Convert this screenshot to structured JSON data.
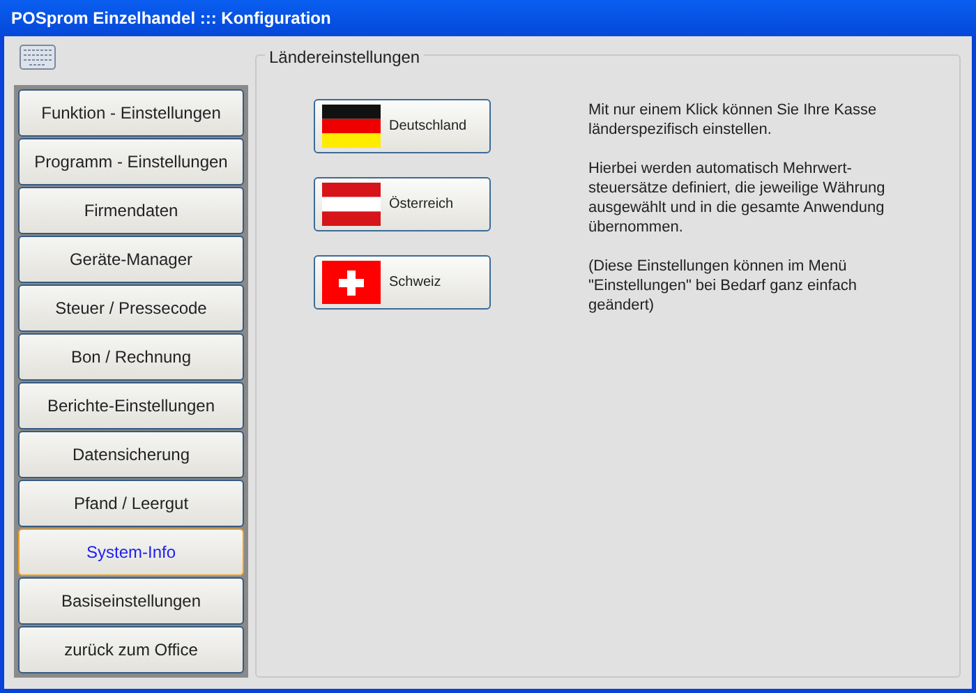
{
  "window": {
    "title": "POSprom Einzelhandel ::: Konfiguration"
  },
  "sidebar": {
    "items": [
      {
        "label": "Funktion - Einstellungen",
        "selected": false
      },
      {
        "label": "Programm - Einstellungen",
        "selected": false
      },
      {
        "label": "Firmendaten",
        "selected": false
      },
      {
        "label": "Geräte-Manager",
        "selected": false
      },
      {
        "label": "Steuer / Pressecode",
        "selected": false
      },
      {
        "label": "Bon / Rechnung",
        "selected": false
      },
      {
        "label": "Berichte-Einstellungen",
        "selected": false
      },
      {
        "label": "Datensicherung",
        "selected": false
      },
      {
        "label": "Pfand / Leergut",
        "selected": false
      },
      {
        "label": "System-Info",
        "selected": true
      },
      {
        "label": "Basiseinstellungen",
        "selected": false
      },
      {
        "label": "zurück zum Office",
        "selected": false
      }
    ]
  },
  "group": {
    "title": "Ländereinstellungen",
    "countries": [
      {
        "kind": "germany",
        "label": "Deutschland"
      },
      {
        "kind": "austria",
        "label": "Österreich"
      },
      {
        "kind": "switzerland",
        "label": "Schweiz"
      }
    ],
    "paragraphs": [
      "Mit nur einem Klick können Sie Ihre Kasse länderspezifisch einstellen.",
      "Hierbei werden automatisch Mehrwert-steuersätze definiert, die jeweilige Währung ausgewählt und in die gesamte Anwendung übernommen.",
      "(Diese Einstellungen können im Menü \"Einstellungen\" bei Bedarf ganz einfach geändert)"
    ]
  }
}
